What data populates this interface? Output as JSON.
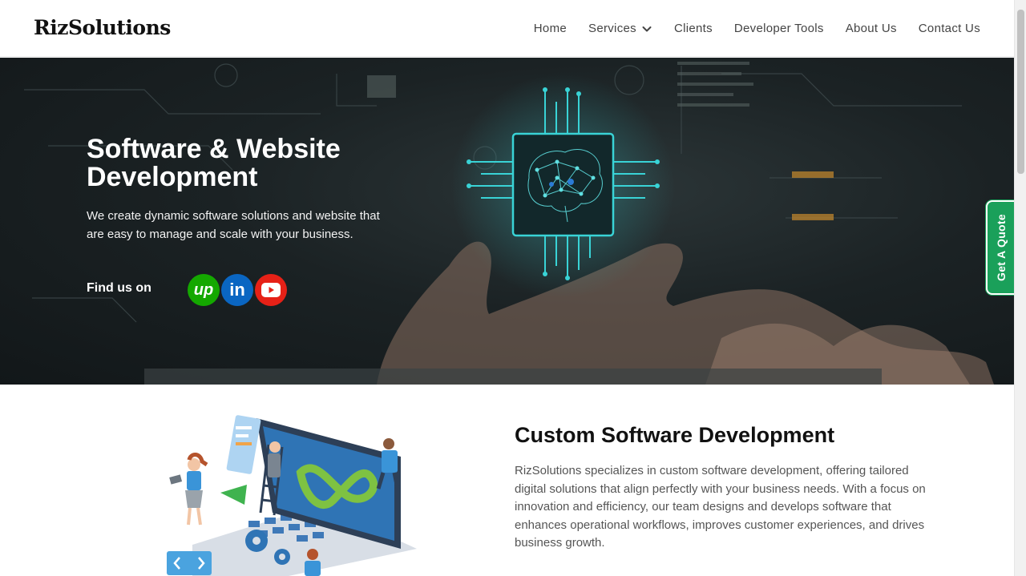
{
  "header": {
    "logo": "RizSolutions",
    "nav": [
      {
        "label": "Home"
      },
      {
        "label": "Services"
      },
      {
        "label": "Clients"
      },
      {
        "label": "Developer Tools"
      },
      {
        "label": "About Us"
      },
      {
        "label": "Contact Us"
      }
    ]
  },
  "hero": {
    "title": "Software & Website Development",
    "subtitle": "We create dynamic software solutions and website that are easy to manage and scale with your business.",
    "find_us": "Find us on",
    "social": [
      {
        "name": "upwork",
        "glyph": "up",
        "color": "#14a800"
      },
      {
        "name": "linkedin",
        "glyph": "in",
        "color": "#0a66c2"
      },
      {
        "name": "youtube",
        "color": "#e62117"
      }
    ]
  },
  "quote_tab": {
    "label": "Get A Quote",
    "color": "#1aa05a"
  },
  "section": {
    "title": "Custom Software Development",
    "text": "RizSolutions specializes in custom software development, offering tailored digital solutions that align perfectly with your business needs. With a focus on innovation and efficiency, our team designs and develops software that enhances operational workflows, improves customer experiences, and drives business growth."
  }
}
